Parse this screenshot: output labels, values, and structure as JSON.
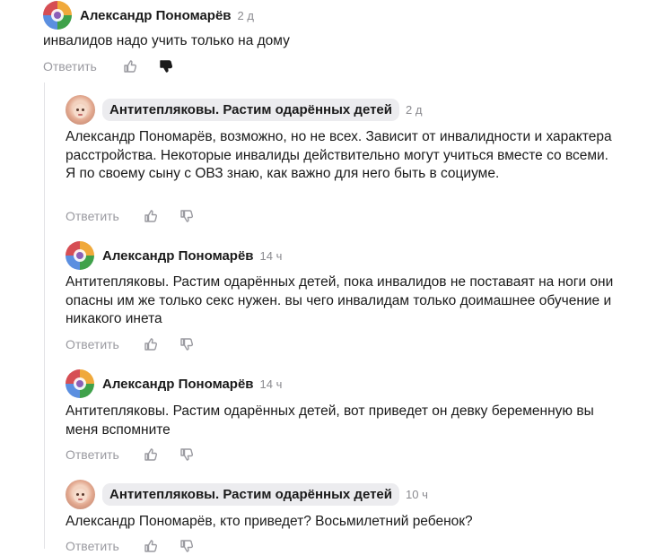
{
  "comments": [
    {
      "author": "Александр Пономарёв",
      "time": "2 д",
      "text": "инвалидов надо учить только на дому",
      "reply_label": "Ответить",
      "disliked": true
    },
    {
      "author": "Антитепляковы. Растим одарённых детей",
      "time": "2 д",
      "text": "Александр Пономарёв, возможно, но не всех. Зависит от инвалидности и характера расстройства. Некоторые инвалиды действительно могут учиться вместе со всеми. Я по своему сыну с ОВЗ знаю, как важно для него быть в социуме.",
      "reply_label": "Ответить"
    },
    {
      "author": "Александр Пономарёв",
      "time": "14 ч",
      "text": "Антитепляковы. Растим одарённых детей, пока инвалидов не поставаят на ноги они опасны им же только секс нужен. вы чего инвалидам только доимашнее обучение и никакого инета",
      "reply_label": "Ответить"
    },
    {
      "author": "Александр Пономарёв",
      "time": "14 ч",
      "text": "Антитепляковы. Растим одарённых детей, вот приведет он девку беременную вы меня вспомните",
      "reply_label": "Ответить"
    },
    {
      "author": "Антитепляковы. Растим одарённых детей",
      "time": "10 ч",
      "text": "Александр Пономарёв, кто приведет? Восьмилетний ребенок?",
      "reply_label": "Ответить"
    }
  ],
  "icons": {
    "like": "thumbs-up-icon",
    "dislike": "thumbs-down-icon"
  },
  "colors": {
    "muted_text": "#9a9aa0",
    "pill_background": "#ececef"
  }
}
